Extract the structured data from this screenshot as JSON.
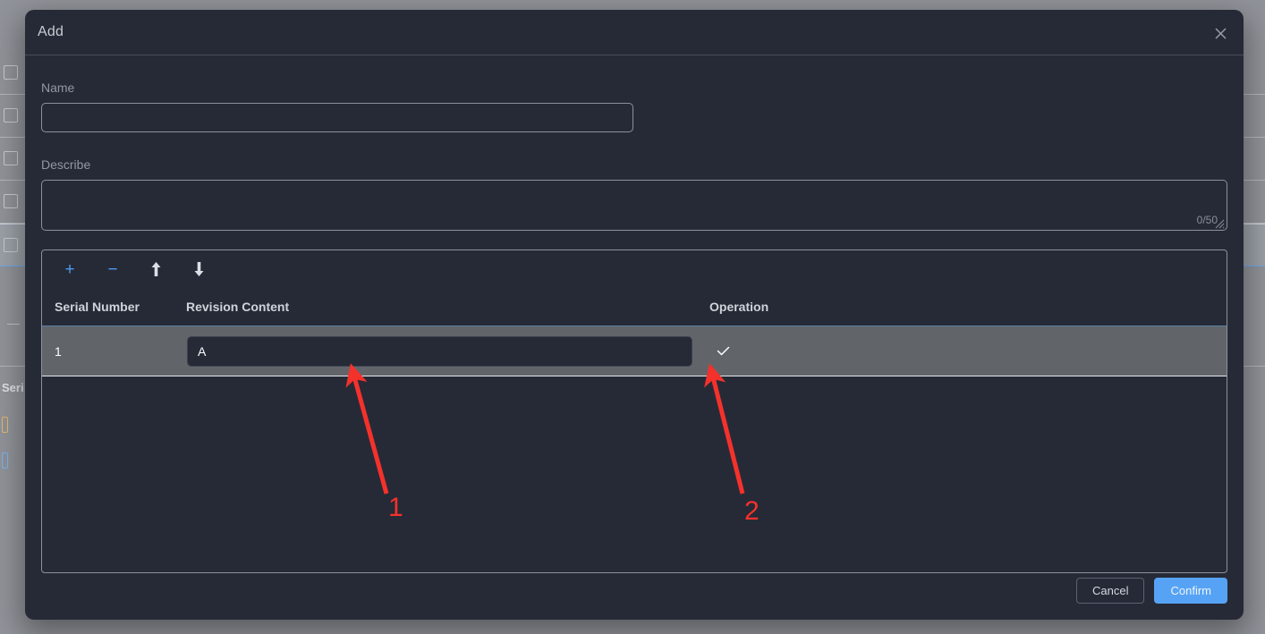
{
  "dialog": {
    "title": "Add",
    "close_icon": "close-icon"
  },
  "form": {
    "name_label": "Name",
    "name_value": "",
    "name_placeholder": "",
    "describe_label": "Describe",
    "describe_value": "",
    "describe_placeholder": "",
    "describe_counter": "0/50"
  },
  "table": {
    "toolbar": [
      {
        "name": "add-row-button",
        "glyph": "+",
        "style": "blue"
      },
      {
        "name": "remove-row-button",
        "glyph": "−",
        "style": "blue"
      },
      {
        "name": "move-up-button",
        "glyph": "↑",
        "style": "white"
      },
      {
        "name": "move-down-button",
        "glyph": "↓",
        "style": "white"
      }
    ],
    "columns": [
      "Serial Number",
      "Revision Content",
      "Operation"
    ],
    "rows": [
      {
        "serial": "1",
        "revision_content": "A",
        "revision_placeholder": "",
        "operation_icon": "check-icon"
      }
    ]
  },
  "footer": {
    "cancel_label": "Cancel",
    "confirm_label": "Confirm"
  },
  "annotations": [
    {
      "label": "1"
    },
    {
      "label": "2"
    }
  ],
  "background": {
    "partial_text": "Seri"
  },
  "colors": {
    "dialog_bg": "#262a36",
    "overlay_bg": "#909399",
    "accent_blue": "#56a3f5",
    "toolbar_blue": "#4b9bf0",
    "annotation_red": "#f5312c",
    "row_highlight": "#61656a"
  }
}
